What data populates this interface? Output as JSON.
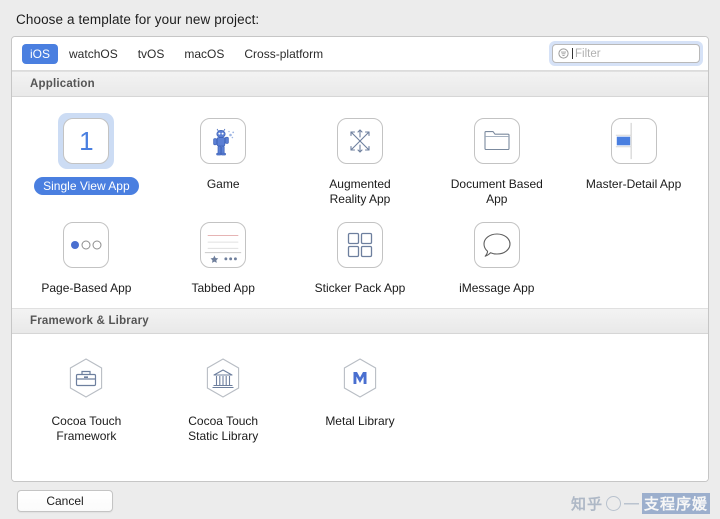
{
  "dialog": {
    "title": "Choose a template for your new project:"
  },
  "toolbar": {
    "tabs": [
      {
        "label": "iOS",
        "active": true
      },
      {
        "label": "watchOS",
        "active": false
      },
      {
        "label": "tvOS",
        "active": false
      },
      {
        "label": "macOS",
        "active": false
      },
      {
        "label": "Cross-platform",
        "active": false
      }
    ],
    "filter": {
      "placeholder": "Filter",
      "value": "",
      "icon": "filter-menu-icon",
      "focused": true
    }
  },
  "sections": [
    {
      "header": "Application",
      "items": [
        {
          "label": "Single View App",
          "icon": "single-view-icon",
          "selected": true
        },
        {
          "label": "Game",
          "icon": "game-robot-icon",
          "selected": false
        },
        {
          "label": "Augmented\nReality App",
          "icon": "augmented-reality-icon",
          "selected": false
        },
        {
          "label": "Document Based\nApp",
          "icon": "folder-icon",
          "selected": false
        },
        {
          "label": "Master-Detail App",
          "icon": "master-detail-icon",
          "selected": false
        },
        {
          "label": "Page-Based App",
          "icon": "page-dots-icon",
          "selected": false
        },
        {
          "label": "Tabbed App",
          "icon": "tab-bar-icon",
          "selected": false
        },
        {
          "label": "Sticker Pack App",
          "icon": "sticker-grid-icon",
          "selected": false
        },
        {
          "label": "iMessage App",
          "icon": "speech-bubble-icon",
          "selected": false
        }
      ]
    },
    {
      "header": "Framework & Library",
      "items": [
        {
          "label": "Cocoa Touch\nFramework",
          "icon": "hex-toolbox-icon",
          "selected": false
        },
        {
          "label": "Cocoa Touch\nStatic Library",
          "icon": "hex-bank-icon",
          "selected": false
        },
        {
          "label": "Metal Library",
          "icon": "hex-metal-m-icon",
          "selected": false
        }
      ]
    }
  ],
  "footer": {
    "cancel_label": "Cancel"
  },
  "watermark": {
    "site": "知乎",
    "dash": "—",
    "handle": "支程序媛"
  },
  "colors": {
    "accent": "#4a7fe0",
    "selection_highlight": "#ccdcf4",
    "window_background": "#ececec",
    "panel_background": "#ffffff",
    "section_header_text": "#555555"
  }
}
